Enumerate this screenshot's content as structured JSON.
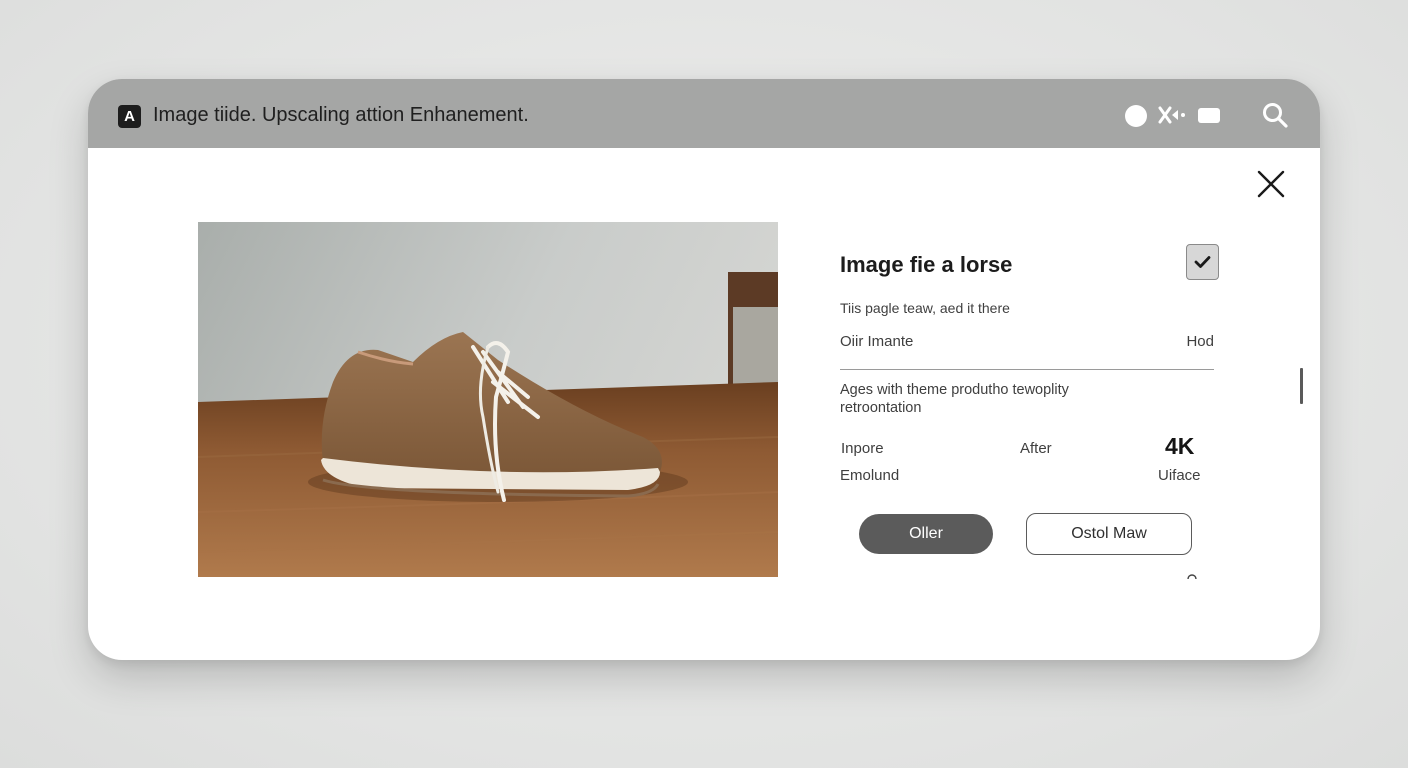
{
  "window": {
    "app_badge": "A",
    "title": "Image tiide. Upscaling attion Enhanement.",
    "toolbar_icons": [
      "circle-icon",
      "mute-icon",
      "rectangle-icon",
      "search-icon"
    ]
  },
  "panel": {
    "title": "Image fie a lorse",
    "checked": true,
    "description": "Tiis pagle teaw, aed it there",
    "row": {
      "label": "Oiir Imante",
      "value": "Hod"
    },
    "note": "Agеs with theme produtho tewoplity retroontation",
    "stats": {
      "before_label": "Inpore",
      "after_label": "After",
      "resolution": "4K",
      "left_sub": "Emolund",
      "right_sub": "Uiface"
    },
    "buttons": {
      "primary": "Oller",
      "secondary": "Ostol Maw"
    }
  },
  "colors": {
    "titlebar": "#a5a6a5",
    "primary_button": "#5b5b5b",
    "shoe": "#8a6646",
    "table_wood": "#8e5a33"
  }
}
